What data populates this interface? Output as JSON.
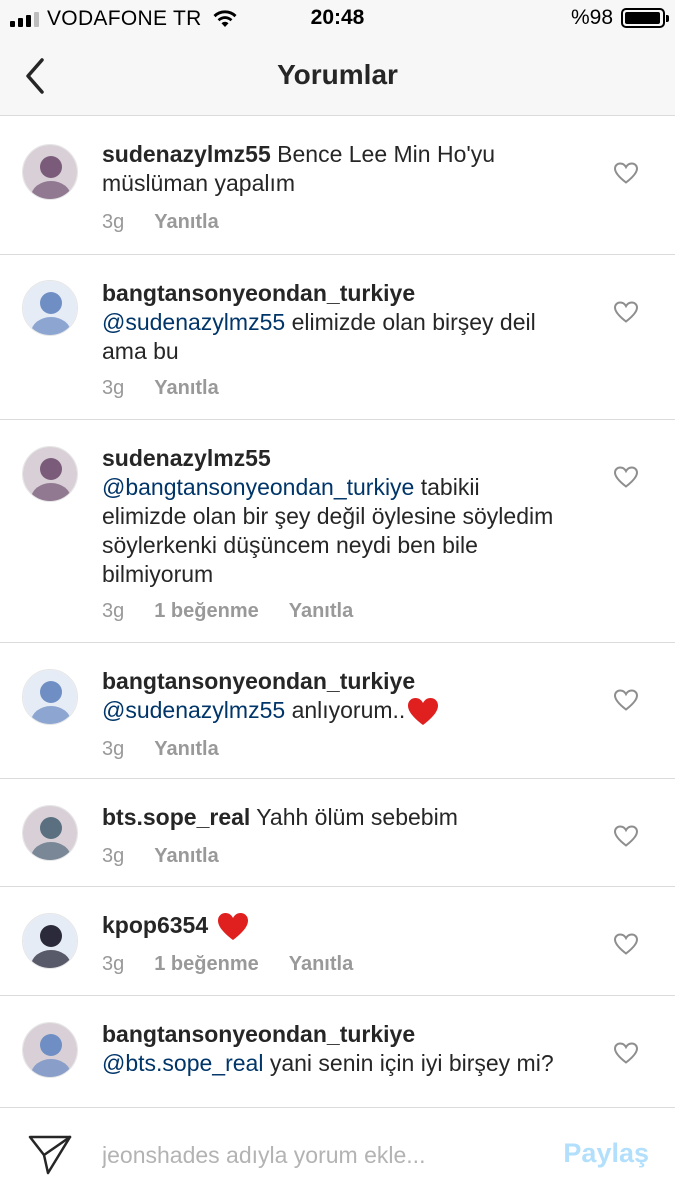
{
  "status_bar": {
    "carrier": "VODAFONE TR",
    "time": "20:48",
    "battery": "%98",
    "battery_level": 0.98
  },
  "header": {
    "title": "Yorumlar"
  },
  "comments": [
    {
      "username": "sudenazylmz55",
      "mention": "",
      "text": "Bence Lee Min Ho'yu müslüman yapalım",
      "time": "3g",
      "likes": "",
      "reply": "Yanıtla",
      "avatar_color": "#7a5c7a"
    },
    {
      "username": "bangtansonyeondan_turkiye",
      "mention": "@sudenazylmz55",
      "text": "elimizde olan birşey deil ama bu",
      "time": "3g",
      "likes": "",
      "reply": "Yanıtla",
      "avatar_color": "#6f8fc4"
    },
    {
      "username": "sudenazylmz55",
      "mention": "@bangtansonyeondan_turkiye",
      "text": "tabikii elimizde olan bir şey değil öylesine söyledim söylerkenki düşüncem neydi ben bile bilmiyorum",
      "time": "3g",
      "likes": "1 beğenme",
      "reply": "Yanıtla",
      "avatar_color": "#7a5c7a"
    },
    {
      "username": "bangtansonyeondan_turkiye",
      "mention": "@sudenazylmz55",
      "text": "anlıyorum..",
      "emoji": "heart",
      "time": "3g",
      "likes": "",
      "reply": "Yanıtla",
      "avatar_color": "#6f8fc4"
    },
    {
      "username": "bts.sope_real",
      "mention": "",
      "text": "Yahh ölüm sebebim",
      "time": "3g",
      "likes": "",
      "reply": "Yanıtla",
      "avatar_color": "#5a6f80"
    },
    {
      "username": "kpop6354",
      "mention": "",
      "text": "",
      "emoji": "heart",
      "time": "3g",
      "likes": "1 beğenme",
      "reply": "Yanıtla",
      "avatar_color": "#2a2a3a"
    },
    {
      "username": "bangtansonyeondan_turkiye",
      "mention": "@bts.sope_real",
      "text": "yani senin için iyi birşey mi?",
      "time": "",
      "likes": "",
      "reply": "",
      "avatar_color": "#6f8fc4"
    }
  ],
  "input_bar": {
    "placeholder": "jeonshades adıyla yorum ekle...",
    "share_label": "Paylaş"
  },
  "icons": {
    "back": "chevron-left-icon",
    "like": "heart-outline-icon",
    "send": "paper-plane-icon",
    "emoji": "red-heart-emoji"
  },
  "colors": {
    "text": "#262626",
    "muted": "#999999",
    "mention": "#003569",
    "share": "#b2dffc",
    "heart_emoji": "#e0201f"
  }
}
